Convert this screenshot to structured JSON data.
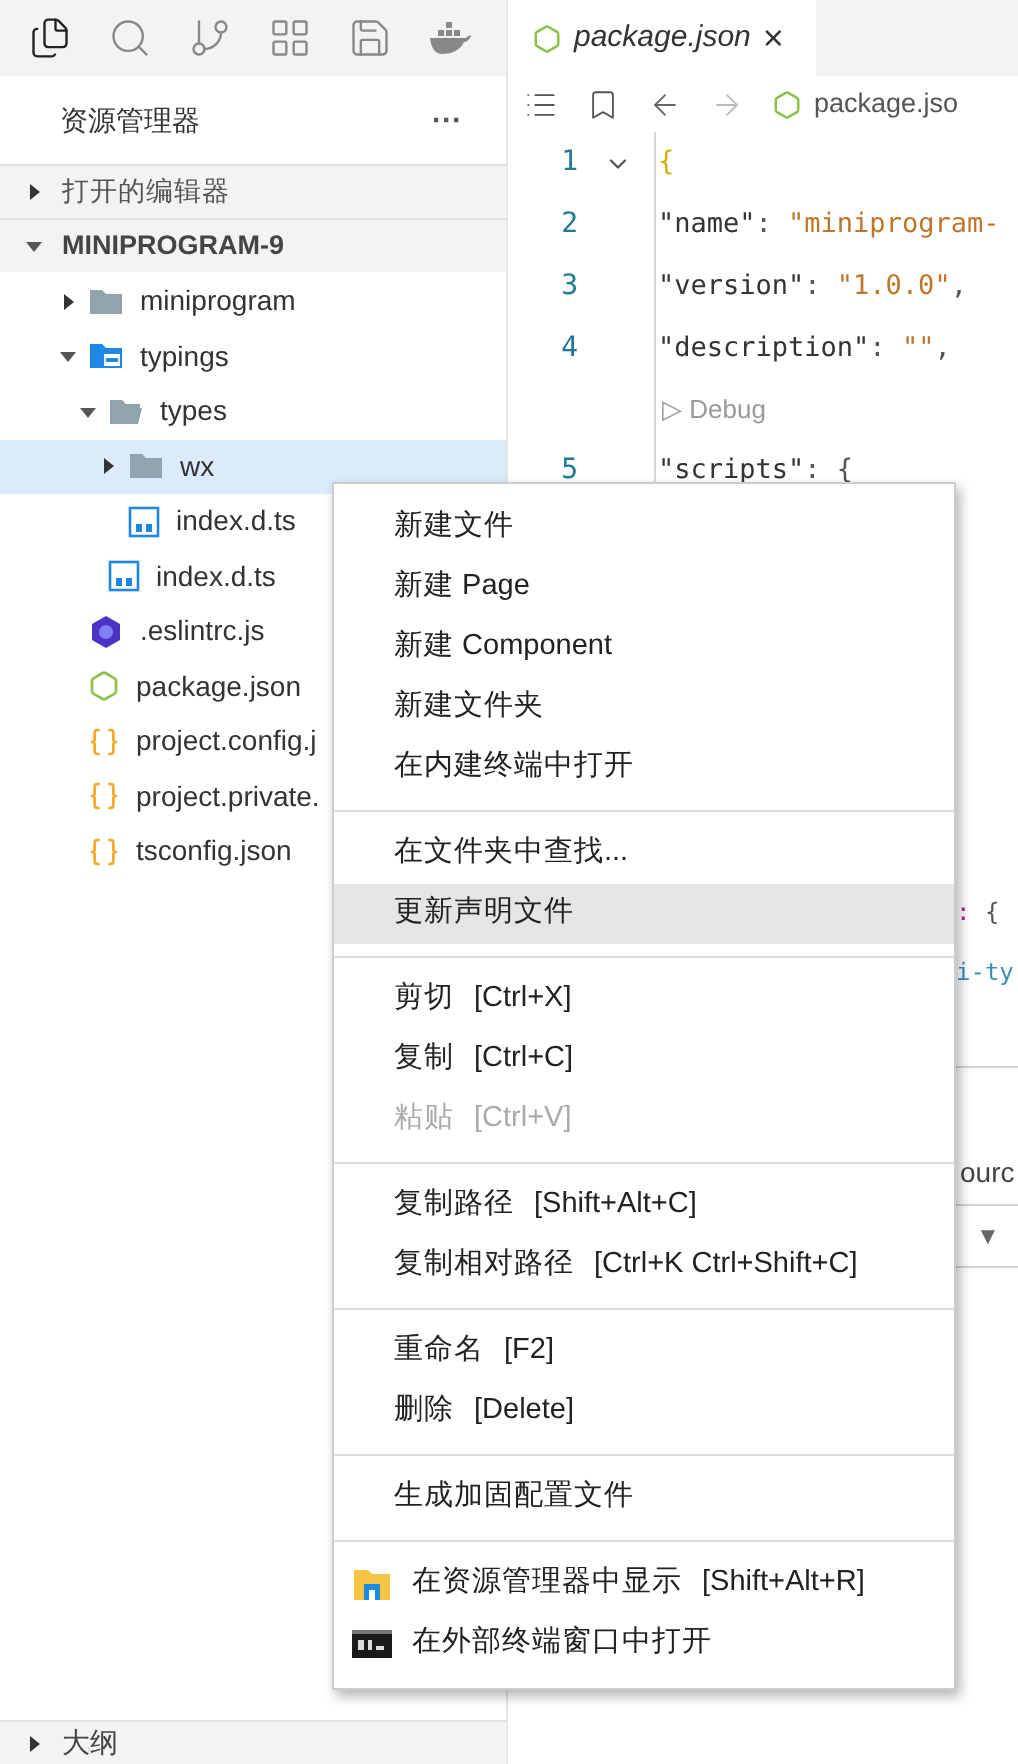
{
  "activity_bar": {
    "items": [
      {
        "kind": "files",
        "selected": true
      },
      {
        "kind": "search",
        "selected": false
      },
      {
        "kind": "git",
        "selected": false
      },
      {
        "kind": "extensions",
        "selected": false
      },
      {
        "kind": "storage",
        "selected": false
      },
      {
        "kind": "docker",
        "selected": false
      }
    ]
  },
  "explorer": {
    "title": "资源管理器",
    "more": "···",
    "sections": [
      {
        "title": "打开的编辑器",
        "expanded": false
      },
      {
        "title": "MINIPROGRAM-9",
        "expanded": true
      }
    ],
    "tree": [
      {
        "name": "miniprogram",
        "kind": "folder",
        "expanded": false,
        "selected": false
      },
      {
        "name": "typings",
        "kind": "ts-folder",
        "expanded": true,
        "selected": false,
        "children": [
          {
            "name": "types",
            "kind": "folder",
            "expanded": true,
            "selected": false,
            "children": [
              {
                "name": "wx",
                "kind": "folder",
                "expanded": false,
                "selected": true
              },
              {
                "name": "index.d.ts",
                "kind": "ts",
                "selected": false
              }
            ]
          },
          {
            "name": "index.d.ts",
            "kind": "ts",
            "selected": false
          }
        ]
      },
      {
        "name": ".eslintrc.js",
        "kind": "eslint",
        "selected": false
      },
      {
        "name": "package.json",
        "kind": "js-json",
        "selected": false
      },
      {
        "name": "project.config.j",
        "kind": "json",
        "selected": false
      },
      {
        "name": "project.private.",
        "kind": "json",
        "selected": false
      },
      {
        "name": "tsconfig.json",
        "kind": "json",
        "selected": false
      }
    ],
    "outline": {
      "title": "大纲",
      "expanded": false
    }
  },
  "editor": {
    "tab": {
      "title": "package.json",
      "close": "×"
    },
    "breadcrumb": "package.jso",
    "lines": [
      {
        "number": "1",
        "folded": false,
        "tokens": [
          {
            "kind": "brace",
            "text": "{"
          }
        ]
      },
      {
        "number": "2",
        "tokens": [
          {
            "kind": "key",
            "text": "\"name\""
          },
          {
            "kind": "punct",
            "text": ": "
          },
          {
            "kind": "string",
            "text": "\"miniprogram-"
          }
        ]
      },
      {
        "number": "3",
        "tokens": [
          {
            "kind": "key",
            "text": "\"version\""
          },
          {
            "kind": "punct",
            "text": ": "
          },
          {
            "kind": "string",
            "text": "\"1.0.0\""
          },
          {
            "kind": "punct",
            "text": ","
          }
        ]
      },
      {
        "number": "4",
        "tokens": [
          {
            "kind": "key",
            "text": "\"description\""
          },
          {
            "kind": "punct",
            "text": ": "
          },
          {
            "kind": "string",
            "text": "\"\""
          },
          {
            "kind": "punct",
            "text": ","
          }
        ]
      },
      {
        "kind": "codelens",
        "icon": "▷",
        "text": "Debug"
      },
      {
        "number": "5",
        "tokens": [
          {
            "kind": "key",
            "text": "\"scripts\""
          },
          {
            "kind": "punct",
            "text": ": {"
          }
        ]
      }
    ],
    "fragments": [
      [
        {
          "kind": "keyword",
          "text": ":"
        },
        {
          "kind": "punct",
          "text": " {"
        }
      ],
      [
        {
          "kind": "value",
          "text": "i-ty"
        }
      ]
    ],
    "panel": {
      "row_text": "ourc",
      "toggle": "▼"
    }
  },
  "context_menu": {
    "groups": [
      [
        {
          "label": "新建文件",
          "disabled": false,
          "selected": false
        },
        {
          "label": "新建 Page",
          "disabled": false,
          "selected": false
        },
        {
          "label": "新建 Component",
          "disabled": false,
          "selected": false
        },
        {
          "label": "新建文件夹",
          "disabled": false,
          "selected": false
        },
        {
          "label": "在内建终端中打开",
          "disabled": false,
          "selected": false
        }
      ],
      [
        {
          "label": "在文件夹中查找...",
          "disabled": false,
          "selected": false
        },
        {
          "label": "更新声明文件",
          "disabled": false,
          "selected": true
        }
      ],
      [
        {
          "label": "剪切",
          "shortcut": "[Ctrl+X]",
          "disabled": false,
          "selected": false
        },
        {
          "label": "复制",
          "shortcut": "[Ctrl+C]",
          "disabled": false,
          "selected": false
        },
        {
          "label": "粘贴",
          "shortcut": "[Ctrl+V]",
          "disabled": true,
          "selected": false
        }
      ],
      [
        {
          "label": "复制路径",
          "shortcut": "[Shift+Alt+C]",
          "disabled": false,
          "selected": false
        },
        {
          "label": "复制相对路径",
          "shortcut": "[Ctrl+K Ctrl+Shift+C]",
          "disabled": false,
          "selected": false
        }
      ],
      [
        {
          "label": "重命名",
          "shortcut": "[F2]",
          "disabled": false,
          "selected": false
        },
        {
          "label": "删除",
          "shortcut": "[Delete]",
          "disabled": false,
          "selected": false
        }
      ],
      [
        {
          "label": "生成加固配置文件",
          "disabled": false,
          "selected": false
        }
      ],
      [
        {
          "label": "在资源管理器中显示",
          "shortcut": "[Shift+Alt+R]",
          "kind": "reveal",
          "disabled": false,
          "selected": false
        },
        {
          "label": "在外部终端窗口中打开",
          "kind": "terminal",
          "disabled": false,
          "selected": false
        }
      ]
    ]
  }
}
